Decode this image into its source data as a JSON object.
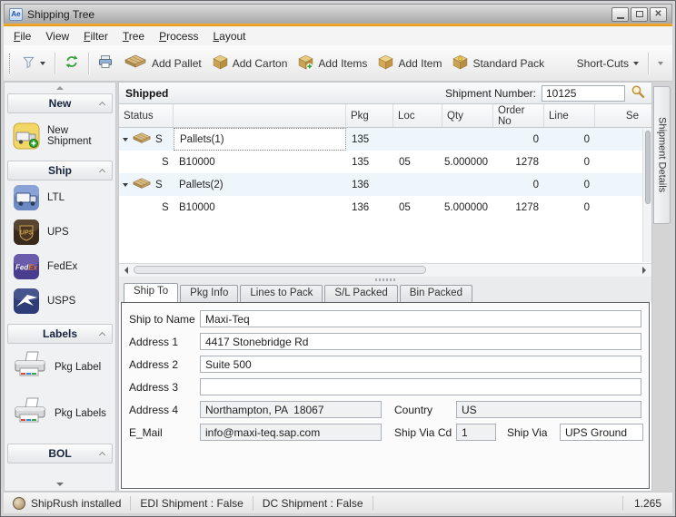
{
  "titlebar": {
    "icon_text": "Ae",
    "title": "Shipping Tree"
  },
  "menubar": {
    "items": [
      "File",
      "View",
      "Filter",
      "Tree",
      "Process",
      "Layout"
    ]
  },
  "toolbar": {
    "add_pallet": "Add Pallet",
    "add_carton": "Add Carton",
    "add_items": "Add Items",
    "add_item": "Add Item",
    "standard_pack": "Standard Pack",
    "shortcuts": "Short-Cuts"
  },
  "sidebar": {
    "groups": [
      {
        "title": "New"
      },
      {
        "title": "Ship"
      },
      {
        "title": "Labels"
      },
      {
        "title": "BOL"
      }
    ],
    "items": {
      "new_shipment": "New Shipment",
      "ltl": "LTL",
      "ups": "UPS",
      "fedex": "FedEx",
      "usps": "USPS",
      "pkg_label": "Pkg Label",
      "pkg_labels": "Pkg Labels"
    },
    "brand": {
      "ups": "UPS",
      "fedex_a": "Fed",
      "fedex_b": "Ex"
    }
  },
  "shipment_panel": {
    "title": "Shipped",
    "number_label": "Shipment Number:",
    "number_value": "10125"
  },
  "grid": {
    "columns": {
      "status": "Status",
      "name": "",
      "pkg": "Pkg",
      "loc": "Loc",
      "qty": "Qty",
      "order_no": "Order No",
      "line": "Line",
      "se": "Se"
    },
    "rows": [
      {
        "status": "S",
        "name": "Pallets(1)",
        "pkg": "135",
        "loc": "",
        "qty": "",
        "order_no": "0",
        "line": "0"
      },
      {
        "status": "S",
        "name": "B10000",
        "pkg": "135",
        "loc": "05",
        "qty": "5.000000",
        "order_no": "1278",
        "line": "0"
      },
      {
        "status": "S",
        "name": "Pallets(2)",
        "pkg": "136",
        "loc": "",
        "qty": "",
        "order_no": "0",
        "line": "0"
      },
      {
        "status": "S",
        "name": "B10000",
        "pkg": "136",
        "loc": "05",
        "qty": "5.000000",
        "order_no": "1278",
        "line": "0"
      }
    ]
  },
  "details_tab": {
    "label": "Shipment Details"
  },
  "tabs": {
    "items": [
      "Ship To",
      "Pkg Info",
      "Lines to Pack",
      "S/L Packed",
      "Bin Packed"
    ]
  },
  "form": {
    "ship_to_name": {
      "label": "Ship to Name",
      "value": "Maxi-Teq"
    },
    "address1": {
      "label": "Address 1",
      "value": "4417 Stonebridge Rd"
    },
    "address2": {
      "label": "Address 2",
      "value": "Suite 500"
    },
    "address3": {
      "label": "Address 3",
      "value": ""
    },
    "address4": {
      "label": "Address 4",
      "value": "Northampton, PA  18067"
    },
    "country": {
      "label": "Country",
      "value": "US"
    },
    "email": {
      "label": "E_Mail",
      "value": "info@maxi-teq.sap.com"
    },
    "ship_via_cd": {
      "label": "Ship Via Cd",
      "value": "1"
    },
    "ship_via": {
      "label": "Ship Via",
      "value": "UPS Ground"
    }
  },
  "statusbar": {
    "shiprush": "ShipRush installed",
    "edi": "EDI Shipment : False",
    "dc": "DC Shipment : False",
    "version": "1.265"
  },
  "colors": {
    "accent_line": "#eda12b",
    "parent_row": "#eef5fb",
    "ups_gold": "#c9a24a",
    "fedex_purple": "#574a94",
    "usps_blue": "#2e3d78",
    "refresh_green": "#35a03a"
  }
}
